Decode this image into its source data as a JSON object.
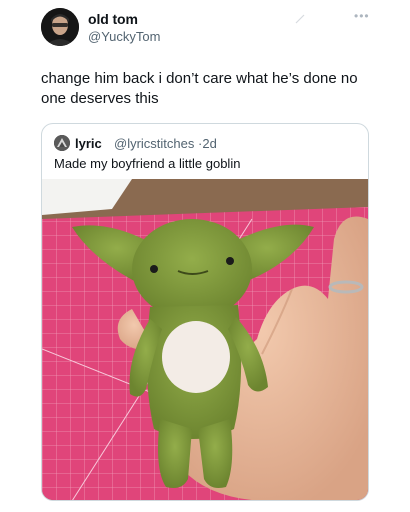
{
  "tweet": {
    "author": {
      "display_name": "old tom",
      "handle": "@YuckyTom",
      "avatar_icon": "profile-avatar"
    },
    "text": "change him back i don’t care what he’s done no one deserves this",
    "more_icon": "•••",
    "quoted_tweet": {
      "author": {
        "display_name": "lyric",
        "handle": "@lyricstitches",
        "time": "2d",
        "avatar_icon": "profile-avatar"
      },
      "meta_separator": "·",
      "text": "Made my boyfriend a little goblin",
      "photo": {
        "subject": "green plush goblin held in a hand over a pink cutting mat",
        "mat_color": "#e0457a",
        "plush_color": "#7f9a3a",
        "belly_color": "#f3ece6"
      }
    }
  },
  "colors": {
    "text_primary": "#0f1419",
    "text_secondary": "#536471",
    "border": "#cfd9de"
  }
}
